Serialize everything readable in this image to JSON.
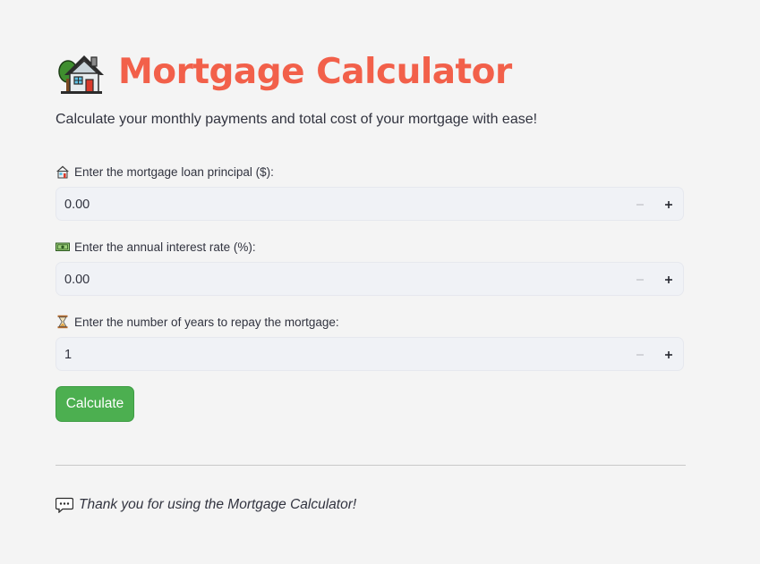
{
  "header": {
    "title": "Mortgage Calculator",
    "icon": "house-with-garden-icon",
    "subtitle": "Calculate your monthly payments and total cost of your mortgage with ease!"
  },
  "fields": [
    {
      "icon": "house-icon",
      "label": "Enter the mortgage loan principal ($):",
      "value": "0.00"
    },
    {
      "icon": "money-icon",
      "label": "Enter the annual interest rate (%):",
      "value": "0.00"
    },
    {
      "icon": "hourglass-icon",
      "label": "Enter the number of years to repay the mortgage:",
      "value": "1"
    }
  ],
  "actions": {
    "calculate_label": "Calculate"
  },
  "footer": {
    "icon": "speech-bubble-icon",
    "thanks": "Thank you for using the Mortgage Calculator!"
  },
  "colors": {
    "title": "#f2604a",
    "button": "#4caf50",
    "background": "#f4f4f4",
    "input_bg": "#f0f2f6"
  }
}
